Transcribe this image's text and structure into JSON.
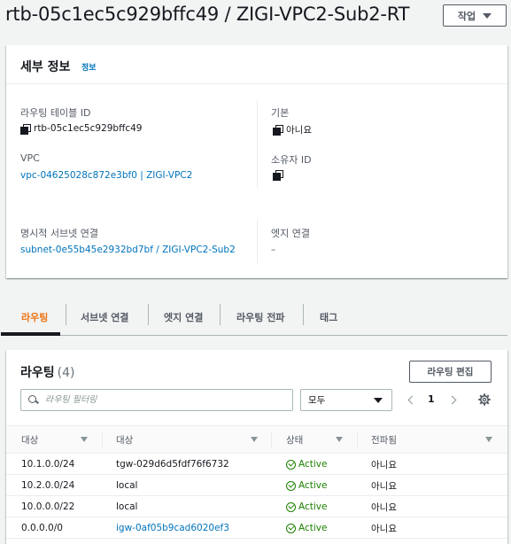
{
  "header": {
    "title": "rtb-05c1ec5c929bffc49 / ZIGI-VPC2-Sub2-RT",
    "actions_label": "작업"
  },
  "details": {
    "title": "세부 정보",
    "info_link": "정보",
    "fields": {
      "route_table_id": {
        "label": "라우팅 테이블 ID",
        "value": "rtb-05c1ec5c929bffc49"
      },
      "main": {
        "label": "기본",
        "value": "아니요"
      },
      "vpc": {
        "label": "VPC",
        "value": "vpc-04625028c872e3bf0 | ZIGI-VPC2"
      },
      "owner_id": {
        "label": "소유자 ID",
        "value": ""
      },
      "explicit_subnet": {
        "label": "명시적 서브넷 연결",
        "value": "subnet-0e55b45e2932bd7bf / ZIGI-VPC2-Sub2"
      },
      "edge": {
        "label": "엣지 연결",
        "value": "–"
      }
    }
  },
  "tabs": [
    {
      "label": "라우팅",
      "active": true
    },
    {
      "label": "서브넷 연결",
      "active": false
    },
    {
      "label": "엣지 연결",
      "active": false
    },
    {
      "label": "라우팅 전파",
      "active": false
    },
    {
      "label": "태그",
      "active": false
    }
  ],
  "routes": {
    "title": "라우팅",
    "count": "(4)",
    "edit_label": "라우팅 편집",
    "search_placeholder": "라우팅 필터링",
    "filter_value": "모두",
    "page": "1",
    "columns": [
      "대상",
      "대상",
      "상태",
      "전파됨"
    ],
    "rows": [
      {
        "destination": "10.1.0.0/24",
        "target": "tgw-029d6d5fdf76f6732",
        "target_link": false,
        "status": "Active",
        "propagated": "아니요"
      },
      {
        "destination": "10.2.0.0/24",
        "target": "local",
        "target_link": false,
        "status": "Active",
        "propagated": "아니요"
      },
      {
        "destination": "10.0.0.0/22",
        "target": "local",
        "target_link": false,
        "status": "Active",
        "propagated": "아니요"
      },
      {
        "destination": "0.0.0.0/0",
        "target": "igw-0af05b9cad6020ef3",
        "target_link": true,
        "status": "Active",
        "propagated": "아니요"
      }
    ]
  },
  "colors": {
    "link": "#0073bb",
    "active_tab": "#ec7211",
    "status_ok": "#1d8102"
  }
}
